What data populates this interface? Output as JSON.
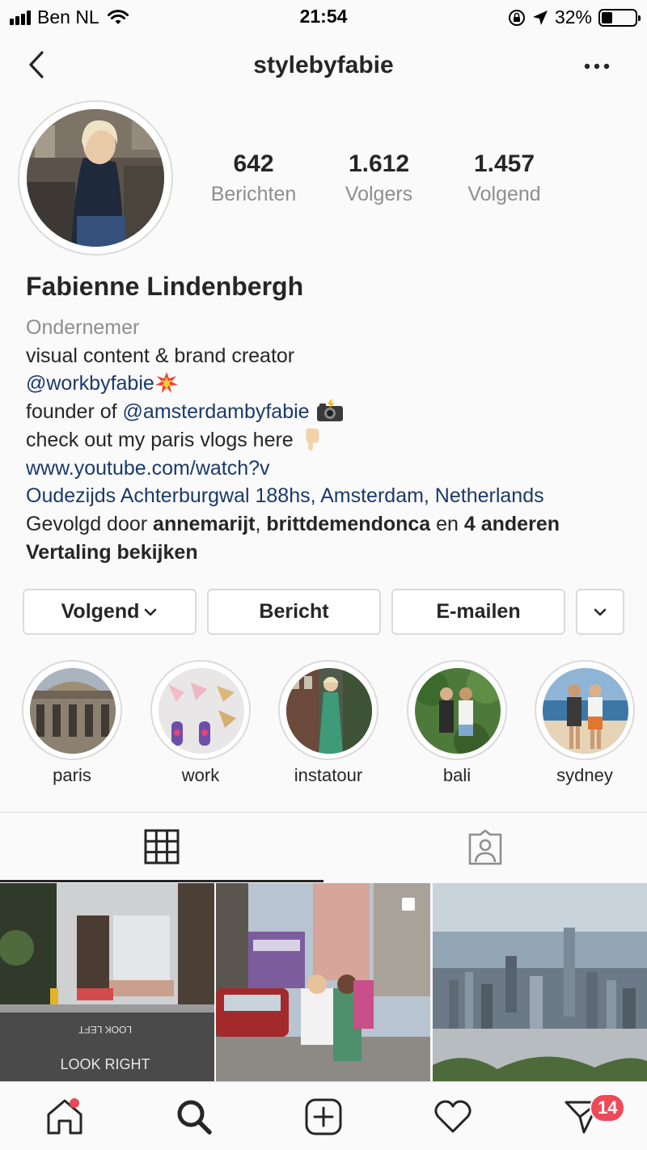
{
  "status_bar": {
    "carrier": "Ben NL",
    "time": "21:54",
    "battery_percent": "32%",
    "battery_level": 0.32,
    "icons": [
      "signal-icon",
      "wifi-icon",
      "orientation-lock-icon",
      "location-arrow-icon",
      "battery-icon"
    ]
  },
  "nav": {
    "title": "stylebyfabie",
    "icons": [
      "back-chevron-icon",
      "more-dots-icon"
    ]
  },
  "profile": {
    "stats": [
      {
        "value": "642",
        "label": "Berichten"
      },
      {
        "value": "1.612",
        "label": "Volgers"
      },
      {
        "value": "1.457",
        "label": "Volgend"
      }
    ],
    "full_name": "Fabienne Lindenbergh",
    "category": "Ondernemer",
    "bio_line1": "visual content & brand creator",
    "bio_mention1": "@workbyfabie",
    "bio_founder_prefix": "founder of ",
    "bio_mention2": "@amsterdambyfabie",
    "bio_vlogs": "check out my paris vlogs here",
    "website": "www.youtube.com/watch?v",
    "address": "Oudezijds Achterburgwal 188hs, Amsterdam, Netherlands",
    "followed_prefix": "Gevolgd door ",
    "followed_user1": "annemarijt",
    "followed_sep": ", ",
    "followed_user2": "brittdemendonca",
    "followed_and": " en ",
    "followed_others": "4 anderen",
    "translate": "Vertaling bekijken"
  },
  "actions": {
    "follow_label": "Volgend",
    "message_label": "Bericht",
    "email_label": "E-mailen"
  },
  "highlights": [
    {
      "label": "paris"
    },
    {
      "label": "work"
    },
    {
      "label": "instatour"
    },
    {
      "label": "bali"
    },
    {
      "label": "sydney"
    }
  ],
  "tabs": [
    {
      "icon": "grid-icon",
      "active": true
    },
    {
      "icon": "tagged-person-icon",
      "active": false
    }
  ],
  "bottom_nav": {
    "items": [
      "home-icon",
      "search-icon",
      "new-post-icon",
      "activity-heart-icon",
      "direct-messages-icon"
    ],
    "direct_badge": "14"
  },
  "colors": {
    "link": "#1b3a6b",
    "muted": "#8e8e8e",
    "badge": "#ed4956",
    "border": "#dbdbdb"
  }
}
